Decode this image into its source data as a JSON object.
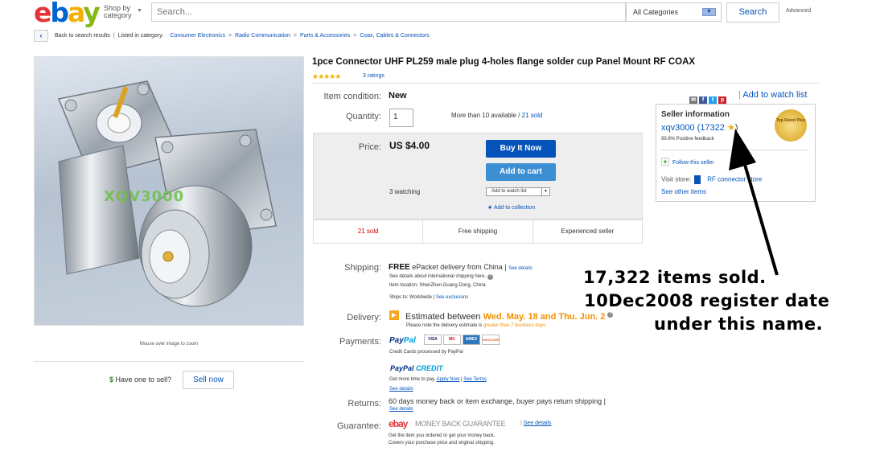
{
  "header": {
    "logo": {
      "e": "e",
      "b": "b",
      "a": "a",
      "y": "y"
    },
    "shop_by_line1": "Shop by",
    "shop_by_line2": "category",
    "search_placeholder": "Search...",
    "category_select": "All Categories",
    "search_button": "Search",
    "advanced_link": "Advanced"
  },
  "breadcrumb": {
    "back_label": "Back to search results",
    "listed_in": "Listed in category:",
    "items": [
      "Consumer Electronics",
      "Radio Communication",
      "Parts & Accessories",
      "Coax, Cables & Connectors"
    ]
  },
  "image": {
    "watermark": "XQV3000",
    "mouse_over": "Mouse over image to zoom",
    "have_one": "Have one to sell?",
    "dollar": "$",
    "sell_now": "Sell now"
  },
  "listing": {
    "title": "1pce Connector UHF PL259 male plug 4-holes flange solder cup Panel Mount RF COAX",
    "stars": "★★★★★",
    "rating_value": 5,
    "ratings_link": "3 ratings",
    "watch_link": "Add to watch list",
    "social_icons": [
      "email-icon",
      "facebook-icon",
      "twitter-icon",
      "pinterest-icon"
    ],
    "condition_label": "Item condition:",
    "condition_value": "New",
    "quantity_label": "Quantity:",
    "quantity_value": "1",
    "availability": "More than 10 available /",
    "sold_link": "21 sold",
    "price_label": "Price:",
    "price_value": "US $4.00",
    "buy_now": "Buy It Now",
    "add_cart": "Add to cart",
    "watching": "3 watching",
    "add_watch_btn": "Add to watch list",
    "add_collection": "Add to collection",
    "stats": [
      "21 sold",
      "Free shipping",
      "Experienced seller"
    ]
  },
  "seller": {
    "title": "Seller information",
    "name": "xqv3000",
    "feedback": "(17322",
    "feedback_close": ")",
    "positive": "99.8% Positive feedback",
    "badge": "Top Rated Plus",
    "follow": "Follow this seller",
    "visit_label": "Visit store:",
    "store_name": "RF connector store",
    "other_items": "See other items"
  },
  "details": {
    "shipping_label": "Shipping:",
    "shipping_free": "FREE",
    "shipping_method": "ePacket delivery from China |",
    "see_details": "See details",
    "shipping_line1": "See details about international shipping here.",
    "item_location": "Item location: ShenZhen,Guang Dong, China",
    "ships_to": "Ships to: Worldwide |",
    "see_exclusions": "See exclusions",
    "delivery_label": "Delivery:",
    "delivery_prefix": "Estimated between",
    "delivery_dates": "Wed. May. 18 and Thu. Jun. 2",
    "delivery_note": "Please note the delivery estimate is",
    "delivery_note_org": "greater than 7 business days.",
    "payments_label": "Payments:",
    "paypal_a": "Pay",
    "paypal_b": "Pal",
    "cards": [
      "VISA",
      "MC",
      "AMEX",
      "DISCOVER"
    ],
    "cards_note": "Credit Cards processed by PayPal",
    "paypal_credit_a": "PayPal",
    "paypal_credit_b": "CREDIT",
    "credit_note": "Get more time to pay.",
    "apply_now": "Apply Now",
    "see_terms": "See Terms",
    "see_details2": "See details",
    "returns_label": "Returns:",
    "returns_value": "60 days money back or item exchange, buyer pays return shipping |",
    "see_details3": "See details",
    "guarantee_label": "Guarantee:",
    "guarantee_logo": "ebay",
    "guarantee_text": "MONEY BACK GUARANTEE",
    "see_details4": "See details",
    "guarantee_line1": "Get the item you ordered or get your money back.",
    "guarantee_line2": "Covers your purchase price and original shipping."
  },
  "annotation": {
    "line1": "17,322 items sold.",
    "line2": "10Dec2008 register date",
    "line3": "under this name."
  },
  "colors": {
    "ebay_red": "#e53238",
    "ebay_blue": "#0064d2",
    "ebay_yellow": "#f5af02",
    "ebay_green": "#86b817",
    "link": "#0654ba"
  }
}
